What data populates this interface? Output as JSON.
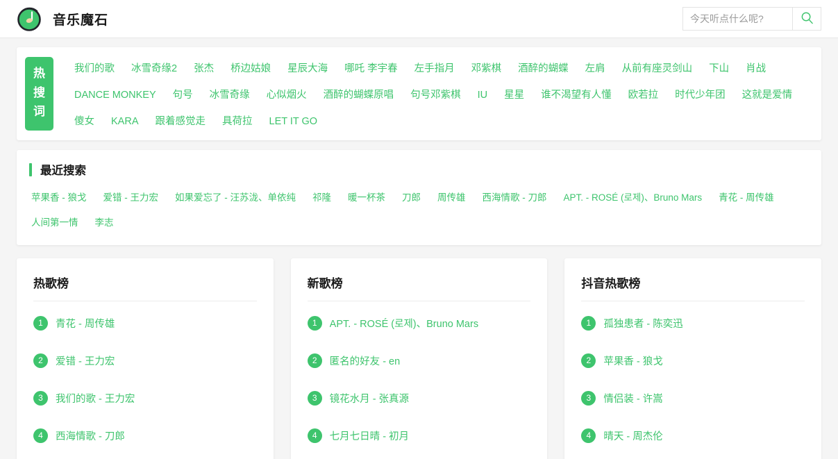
{
  "header": {
    "brand_name": "音乐魔石",
    "logo_icon": "music-note-disc-icon",
    "search_placeholder": "今天听点什么呢?",
    "search_value": "",
    "search_icon": "search-icon"
  },
  "hot_search": {
    "tab_chars": [
      "热",
      "搜",
      "词"
    ],
    "words": [
      "我们的歌",
      "冰雪奇缘2",
      "张杰",
      "桥边姑娘",
      "星辰大海",
      "哪吒 李宇春",
      "左手指月",
      "邓紫棋",
      "酒醉的蝴蝶",
      "左肩",
      "从前有座灵剑山",
      "下山",
      "肖战",
      "DANCE MONKEY",
      "句号",
      "冰雪奇缘",
      "心似烟火",
      "酒醉的蝴蝶原唱",
      "句号邓紫棋",
      "IU",
      "星星",
      "谁不渴望有人懂",
      "欧若拉",
      "时代少年团",
      "这就是爱情",
      "傻女",
      "KARA",
      "跟着感觉走",
      "具荷拉",
      "LET IT GO"
    ]
  },
  "recent_search": {
    "title": "最近搜索",
    "words": [
      "苹果香 - 狼戈",
      "爱错 - 王力宏",
      "如果爱忘了 - 汪苏泷、单依纯",
      "祁隆",
      "暖一杯茶",
      "刀郎",
      "周传雄",
      "西海情歌 - 刀郎",
      "APT. - ROSÉ (로제)、Bruno Mars",
      "青花 - 周传雄",
      "人间第一情",
      "李志"
    ]
  },
  "ranks": [
    {
      "title": "热歌榜",
      "items": [
        {
          "num": "1",
          "text": "青花 - 周传雄"
        },
        {
          "num": "2",
          "text": "爱错 - 王力宏"
        },
        {
          "num": "3",
          "text": "我们的歌 - 王力宏"
        },
        {
          "num": "4",
          "text": "西海情歌 - 刀郎"
        }
      ]
    },
    {
      "title": "新歌榜",
      "items": [
        {
          "num": "1",
          "text": "APT. - ROSÉ (로제)、Bruno Mars"
        },
        {
          "num": "2",
          "text": "匿名的好友 - en"
        },
        {
          "num": "3",
          "text": "镜花水月 - 张真源"
        },
        {
          "num": "4",
          "text": "七月七日晴 - 初月"
        }
      ]
    },
    {
      "title": "抖音热歌榜",
      "items": [
        {
          "num": "1",
          "text": "孤独患者 - 陈奕迅"
        },
        {
          "num": "2",
          "text": "苹果香 - 狼戈"
        },
        {
          "num": "3",
          "text": "情侣装 - 许嵩"
        },
        {
          "num": "4",
          "text": "晴天 - 周杰伦"
        }
      ]
    }
  ],
  "colors": {
    "accent": "#3ec46d",
    "page_bg": "#f5f5f5",
    "card_bg": "#ffffff",
    "text_dark": "#1b1b1b"
  }
}
